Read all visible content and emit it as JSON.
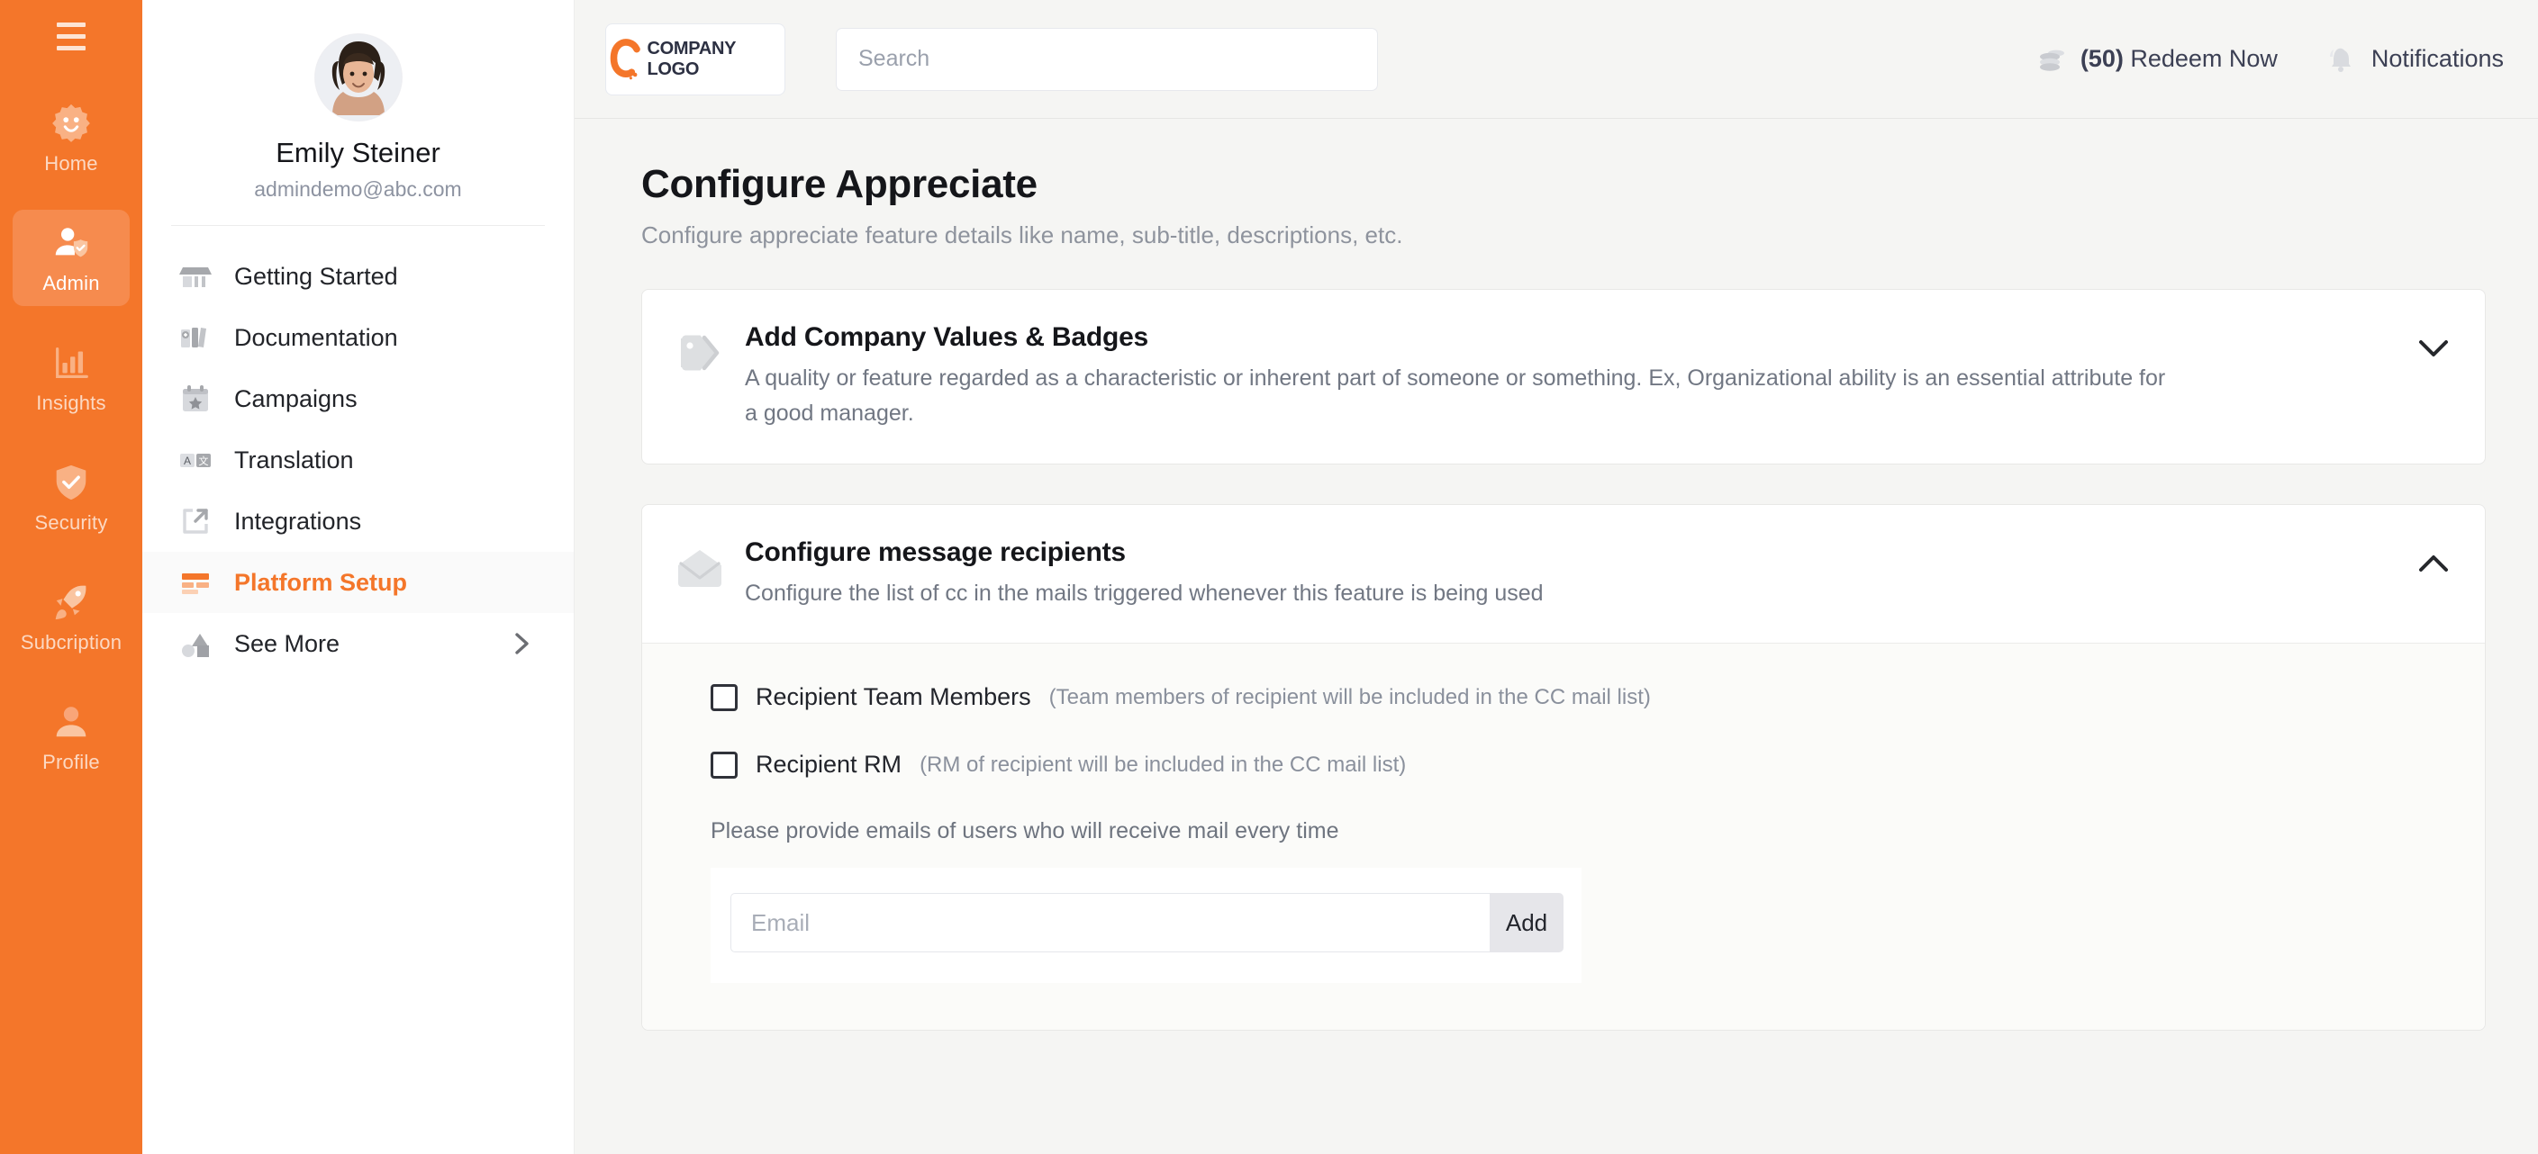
{
  "rail": {
    "menu_icon": "hamburger-icon",
    "items": [
      {
        "label": "Home",
        "icon": "badge-smiley-icon",
        "active": false
      },
      {
        "label": "Admin",
        "icon": "user-shield-icon",
        "active": true
      },
      {
        "label": "Insights",
        "icon": "bar-chart-icon",
        "active": false
      },
      {
        "label": "Security",
        "icon": "shield-check-icon",
        "active": false
      },
      {
        "label": "Subcription",
        "icon": "rocket-icon",
        "active": false
      },
      {
        "label": "Profile",
        "icon": "user-icon",
        "active": false
      }
    ]
  },
  "sidebar": {
    "profile": {
      "name": "Emily Steiner",
      "email": "admindemo@abc.com",
      "avatar": "user-photo-avatar"
    },
    "items": [
      {
        "label": "Getting Started",
        "icon": "storefront-icon",
        "active": false
      },
      {
        "label": "Documentation",
        "icon": "books-icon",
        "active": false
      },
      {
        "label": "Campaigns",
        "icon": "calendar-star-icon",
        "active": false
      },
      {
        "label": "Translation",
        "icon": "translate-icon",
        "active": false
      },
      {
        "label": "Integrations",
        "icon": "external-link-icon",
        "active": false
      },
      {
        "label": "Platform Setup",
        "icon": "layout-blocks-icon",
        "active": true
      },
      {
        "label": "See More",
        "icon": "shapes-icon",
        "active": false,
        "chevron": "chevron-right-icon"
      }
    ]
  },
  "header": {
    "logo_text": "COMPANY LOGO",
    "logo_icon": "company-c-logo-icon",
    "search_placeholder": "Search",
    "search_value": "",
    "redeem": {
      "count": "(50)",
      "label": "Redeem Now",
      "icon": "coins-icon"
    },
    "notifications": {
      "label": "Notifications",
      "icon": "bell-icon"
    }
  },
  "page": {
    "title": "Configure Appreciate",
    "subtitle": "Configure appreciate feature details like name, sub-title, descriptions, etc."
  },
  "cards": [
    {
      "icon": "tags-icon",
      "title": "Add Company Values & Badges",
      "description": "A quality or feature regarded as a characteristic or inherent part of someone or something. Ex, Organizational ability is an essential attribute for a good manager.",
      "chevron": "chevron-down-icon",
      "expanded": false
    },
    {
      "icon": "open-envelope-icon",
      "title": "Configure message recipients",
      "description": "Configure the list of cc in the mails triggered whenever this feature is being used",
      "chevron": "chevron-up-icon",
      "expanded": true
    }
  ],
  "recipients": {
    "checkboxes": [
      {
        "label": "Recipient Team Members",
        "hint": "(Team members of recipient will be included in the CC mail list)",
        "checked": false
      },
      {
        "label": "Recipient RM",
        "hint": "(RM of recipient will be included in the CC mail list)",
        "checked": false
      }
    ],
    "email_note": "Please provide emails of users who will receive mail every time",
    "email_placeholder": "Email",
    "email_value": "",
    "add_label": "Add"
  },
  "colors": {
    "brand_orange": "#F4762A",
    "rail_active": "#F68B4E",
    "page_bg": "#F5F5F3"
  }
}
